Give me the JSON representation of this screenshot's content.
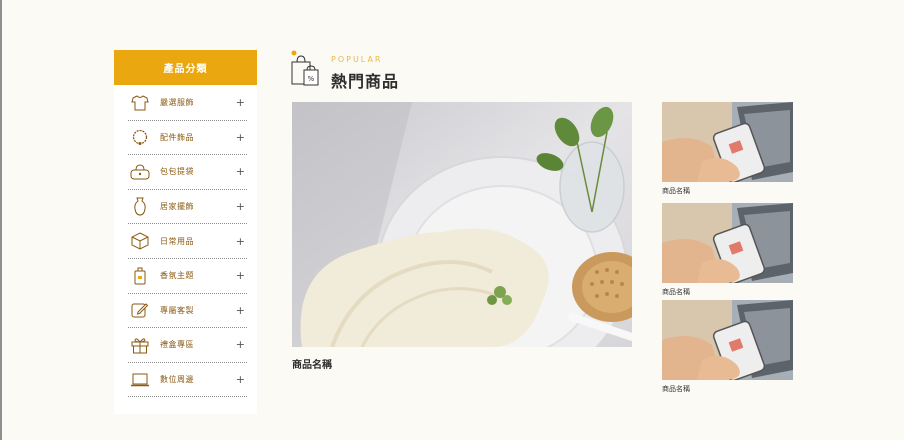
{
  "sidebar": {
    "header": "產品分類",
    "items": [
      {
        "label": "嚴選服飾",
        "icon": "shirt-icon"
      },
      {
        "label": "配件飾品",
        "icon": "necklace-icon"
      },
      {
        "label": "包包提袋",
        "icon": "handbag-icon"
      },
      {
        "label": "居家擺飾",
        "icon": "vase-icon"
      },
      {
        "label": "日常用品",
        "icon": "box-icon"
      },
      {
        "label": "香氛主題",
        "icon": "perfume-icon"
      },
      {
        "label": "專屬客製",
        "icon": "edit-icon"
      },
      {
        "label": "禮盒專區",
        "icon": "gift-icon"
      },
      {
        "label": "數位周邊",
        "icon": "laptop-icon"
      }
    ],
    "expand_symbol": "+"
  },
  "section": {
    "subtitle": "POPULAR",
    "title": "熱門商品"
  },
  "featured": {
    "name": "商品名稱"
  },
  "side_products": [
    {
      "name": "商品名稱"
    },
    {
      "name": "商品名稱"
    },
    {
      "name": "商品名稱"
    }
  ],
  "colors": {
    "accent": "#eba70f",
    "label": "#8b5a12",
    "background": "#fcfaf4"
  }
}
